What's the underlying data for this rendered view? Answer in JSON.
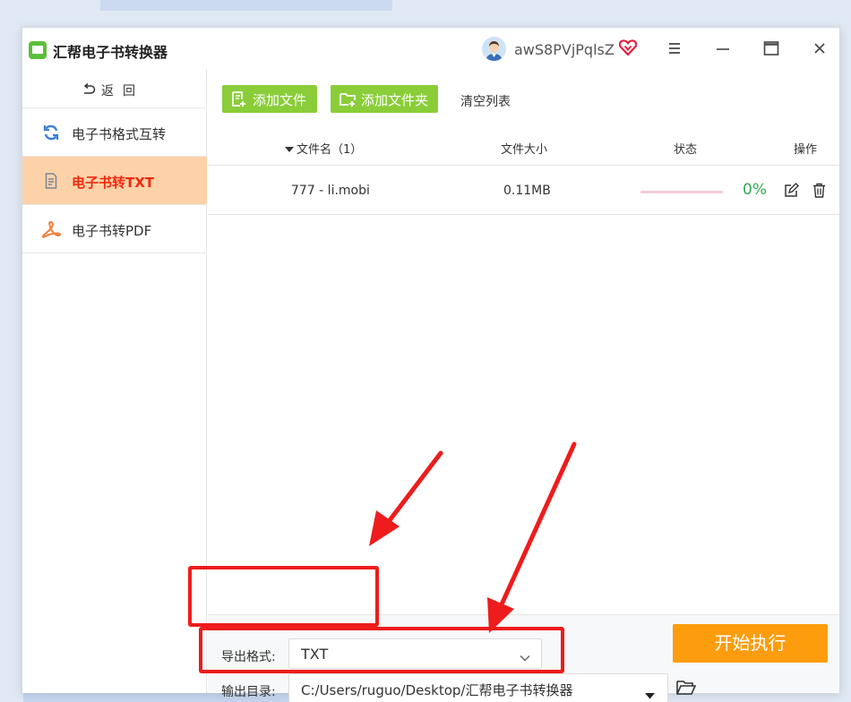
{
  "app": {
    "title": "汇帮电子书转换器",
    "username": "awS8PVjPqlsZ"
  },
  "icons": {
    "logo": "book-logo-icon",
    "vip": "vip-heart-icon",
    "window_controls": [
      "menu-icon",
      "minimize-icon",
      "maximize-icon",
      "close-icon"
    ]
  },
  "colors": {
    "accent_green": "#8acd39",
    "active_bg": "#fdd2a9",
    "active_text": "#f0290f",
    "start_orange": "#fd9d0d",
    "annotation_red": "#ee1c1c"
  },
  "sidebar": {
    "back_label": "返回",
    "items": [
      {
        "label": "电子书格式互转",
        "icon": "refresh-icon",
        "active": false
      },
      {
        "label": "电子书转TXT",
        "icon": "document-icon",
        "active": true
      },
      {
        "label": "电子书转PDF",
        "icon": "pdf-icon",
        "active": false
      }
    ]
  },
  "toolbar": {
    "add_file": "添加文件",
    "add_folder": "添加文件夹",
    "clear_list": "清空列表"
  },
  "table": {
    "columns": [
      "文件名（1）",
      "文件大小",
      "状态",
      "操作"
    ],
    "rows": [
      {
        "name": "777 - li.mobi",
        "size": "0.11MB",
        "progress": 0,
        "status": "0%"
      }
    ]
  },
  "bottom": {
    "format_label": "导出格式:",
    "format_value": "TXT",
    "output_label": "输出目录:",
    "output_value": "C:/Users/ruguo/Desktop/汇帮电子书转换器",
    "start_button": "开始执行"
  }
}
